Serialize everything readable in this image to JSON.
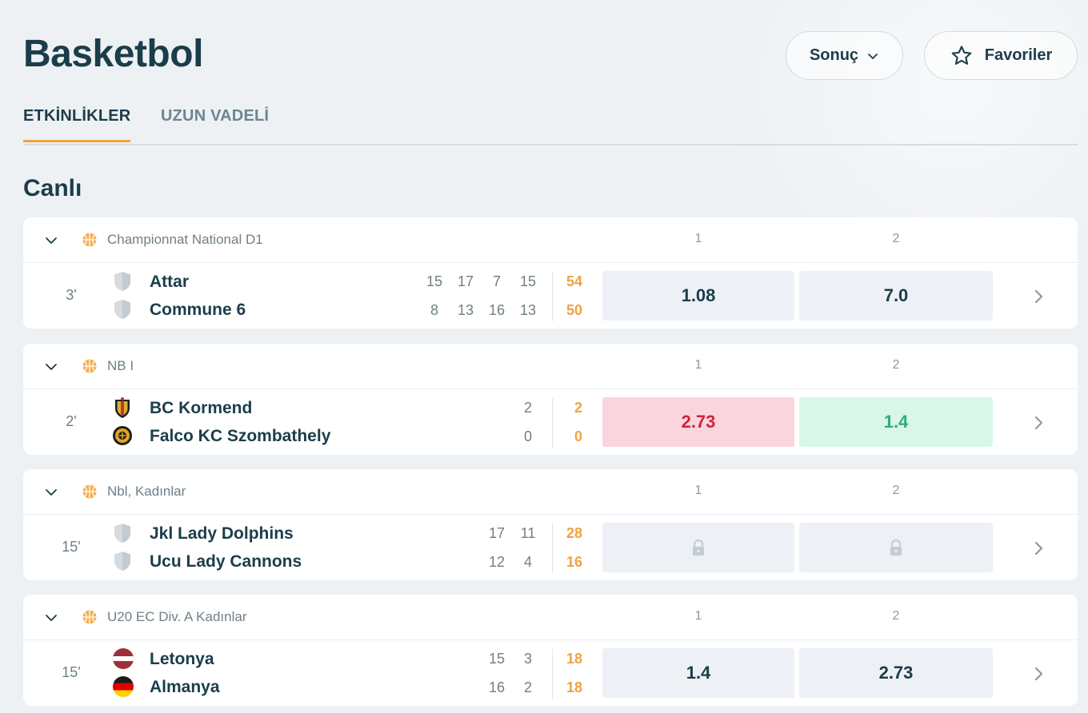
{
  "page": {
    "title": "Basketbol",
    "section_title": "Canlı",
    "colors": {
      "accent": "#f0a33f",
      "text": "#1b3d49",
      "odd_down": "#d0233f",
      "odd_up": "#2eae74"
    }
  },
  "header": {
    "result_button": {
      "label": "Sonuç",
      "icon": "chevron-down-icon"
    },
    "favorites_button": {
      "label": "Favoriler",
      "icon": "star-icon"
    }
  },
  "tabs": [
    {
      "label": "ETKİNLİKLER",
      "active": true
    },
    {
      "label": "UZUN VADELİ",
      "active": false
    }
  ],
  "matches": [
    {
      "league": "Championnat National D1",
      "col1_label": "1",
      "col2_label": "2",
      "minute": "3'",
      "team1": {
        "name": "Attar",
        "icon": "shield-icon",
        "periods": [
          "15",
          "17",
          "7",
          "15"
        ],
        "total": "54"
      },
      "team2": {
        "name": "Commune 6",
        "icon": "shield-icon",
        "periods": [
          "8",
          "13",
          "16",
          "13"
        ],
        "total": "50"
      },
      "odd1": {
        "value": "1.08",
        "state": "normal"
      },
      "odd2": {
        "value": "7.0",
        "state": "normal"
      }
    },
    {
      "league": "NB I",
      "col1_label": "1",
      "col2_label": "2",
      "minute": "2'",
      "team1": {
        "name": "BC Kormend",
        "icon": "club-crest-icon",
        "periods": [
          "2"
        ],
        "total": "2"
      },
      "team2": {
        "name": "Falco KC Szombathely",
        "icon": "club-badge-icon",
        "periods": [
          "0"
        ],
        "total": "0"
      },
      "odd1": {
        "value": "2.73",
        "state": "down"
      },
      "odd2": {
        "value": "1.4",
        "state": "up"
      }
    },
    {
      "league": "Nbl, Kadınlar",
      "col1_label": "1",
      "col2_label": "2",
      "minute": "15'",
      "team1": {
        "name": "Jkl Lady Dolphins",
        "icon": "shield-icon",
        "periods": [
          "17",
          "11"
        ],
        "total": "28"
      },
      "team2": {
        "name": "Ucu Lady Cannons",
        "icon": "shield-icon",
        "periods": [
          "12",
          "4"
        ],
        "total": "16"
      },
      "odd1": {
        "value": "",
        "state": "locked"
      },
      "odd2": {
        "value": "",
        "state": "locked"
      }
    },
    {
      "league": "U20 EC Div. A Kadınlar",
      "col1_label": "1",
      "col2_label": "2",
      "minute": "15'",
      "team1": {
        "name": "Letonya",
        "icon": "latvia-flag-icon",
        "periods": [
          "15",
          "3"
        ],
        "total": "18"
      },
      "team2": {
        "name": "Almanya",
        "icon": "germany-flag-icon",
        "periods": [
          "16",
          "2"
        ],
        "total": "18"
      },
      "odd1": {
        "value": "1.4",
        "state": "normal"
      },
      "odd2": {
        "value": "2.73",
        "state": "normal"
      }
    }
  ]
}
